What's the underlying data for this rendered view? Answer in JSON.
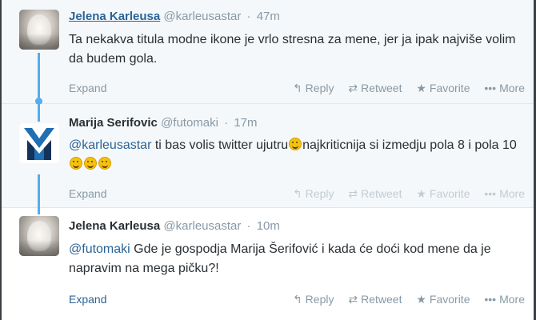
{
  "tweets": [
    {
      "name": "Jelena Karleusa",
      "handle": "@karleusastar",
      "time": "47m",
      "text": "Ta nekakva titula modne ikone je vrlo stresna za mene, jer ja ipak najviše volim da budem gola.",
      "expand": "Expand",
      "avatar": "person-photo"
    },
    {
      "name": "Marija Serifovic",
      "handle": "@futomaki",
      "time": "17m",
      "mention": "@karleusastar",
      "text_a": " ti bas volis twitter ujutru",
      "text_b": "najkriticnija si izmedju pola 8 i pola 10",
      "expand": "Expand",
      "avatar": "m-logo"
    },
    {
      "name": "Jelena Karleusa",
      "handle": "@karleusastar",
      "time": "10m",
      "mention": "@futomaki",
      "text": " Gde je gospodja Marija Šerifović i kada će doći kod mene da je napravim na mega pičku?!",
      "expand": "Expand",
      "avatar": "person-photo"
    }
  ],
  "actions": {
    "reply": "Reply",
    "retweet": "Retweet",
    "favorite": "Favorite",
    "more": "More"
  },
  "icons": {
    "reply": "reply-arrow-icon",
    "retweet": "retweet-icon",
    "favorite": "star-icon",
    "more": "ellipsis-icon",
    "emoji": "grin-emoji-icon",
    "dot": "·"
  },
  "colors": {
    "link": "#2a6496",
    "muted": "#8899a6",
    "conversation_line": "#55acee",
    "logo_blue": "#1f6fb4",
    "logo_navy": "#15325a"
  }
}
